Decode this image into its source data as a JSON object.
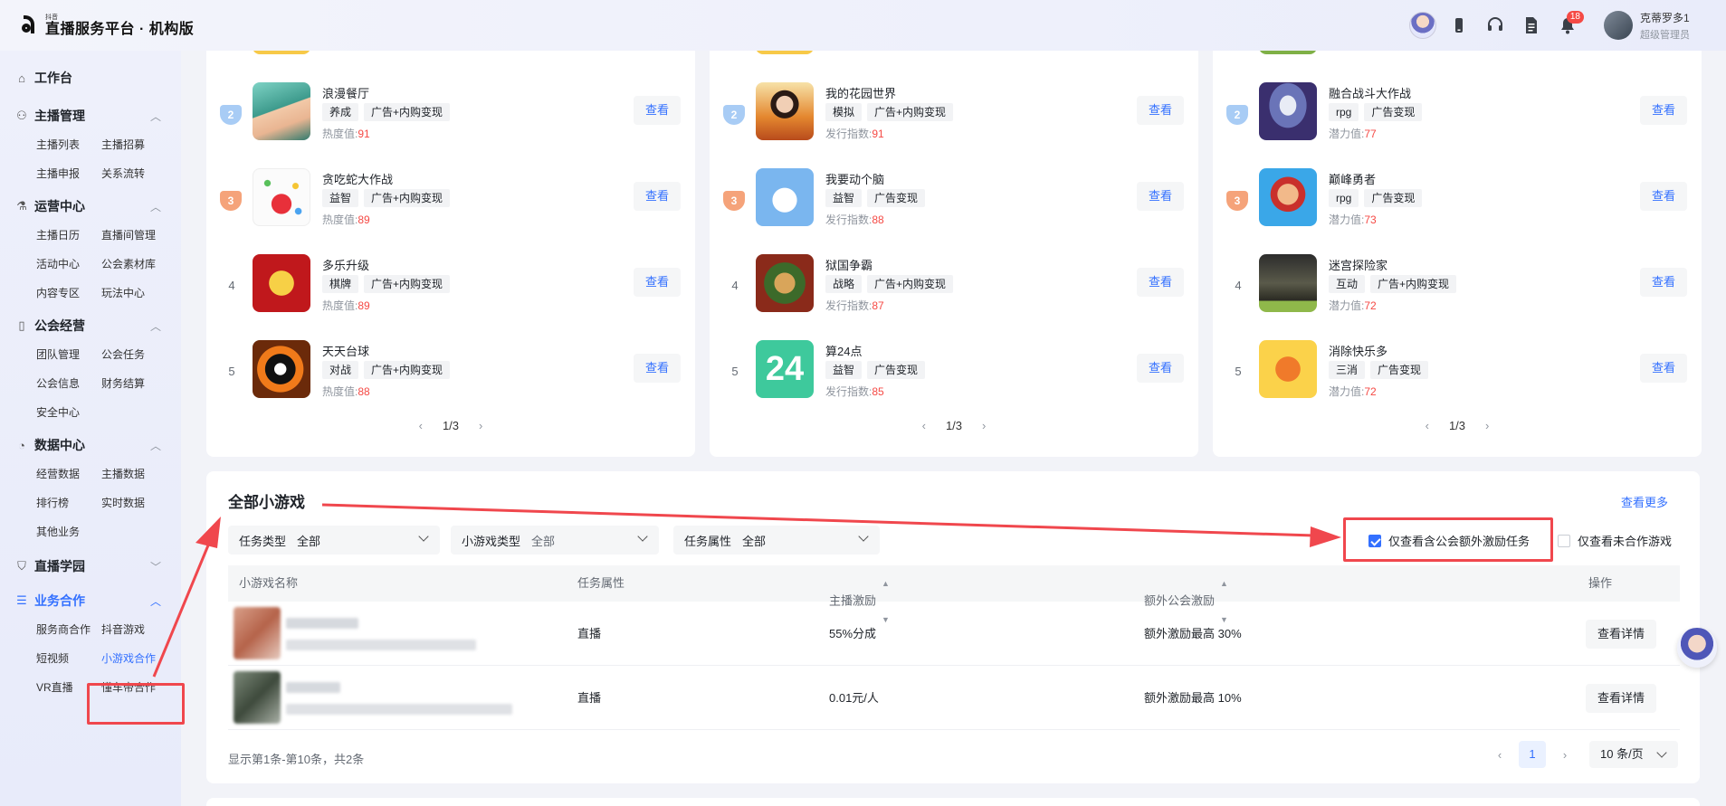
{
  "header": {
    "logo_small": "抖音",
    "title": "直播服务平台 · 机构版",
    "notification_count": "18",
    "user_name": "克蒂罗多1",
    "user_role": "超级管理员"
  },
  "sidebar": {
    "workbench": "工作台",
    "groups": [
      {
        "title": "主播管理",
        "items": [
          "主播列表",
          "主播招募",
          "主播申报",
          "关系流转"
        ]
      },
      {
        "title": "运营中心",
        "items": [
          "主播日历",
          "直播间管理",
          "活动中心",
          "公会素材库",
          "内容专区",
          "玩法中心"
        ]
      },
      {
        "title": "公会经营",
        "items": [
          "团队管理",
          "公会任务",
          "公会信息",
          "财务结算",
          "安全中心"
        ]
      },
      {
        "title": "数据中心",
        "items": [
          "经营数据",
          "主播数据",
          "排行榜",
          "实时数据",
          "其他业务"
        ]
      },
      {
        "title": "直播学园",
        "items": []
      },
      {
        "title": "业务合作",
        "items": [
          "服务商合作",
          "抖音游戏",
          "短视频",
          "小游戏合作",
          "VR直播",
          "懂车帝合作"
        ]
      }
    ]
  },
  "rank_cards": [
    {
      "rows": [
        {
          "rank": "2",
          "name": "浪漫餐厅",
          "tags": [
            "养成",
            "广告+内购变现"
          ],
          "metric_label": "热度值:",
          "metric_value": "91"
        },
        {
          "rank": "3",
          "name": "贪吃蛇大作战",
          "tags": [
            "益智",
            "广告+内购变现"
          ],
          "metric_label": "热度值:",
          "metric_value": "89"
        },
        {
          "rank": "4",
          "name": "多乐升级",
          "tags": [
            "棋牌",
            "广告+内购变现"
          ],
          "metric_label": "热度值:",
          "metric_value": "89"
        },
        {
          "rank": "5",
          "name": "天天台球",
          "tags": [
            "对战",
            "广告+内购变现"
          ],
          "metric_label": "热度值:",
          "metric_value": "88"
        }
      ],
      "page": "1/3"
    },
    {
      "rows": [
        {
          "rank": "2",
          "name": "我的花园世界",
          "tags": [
            "模拟",
            "广告+内购变现"
          ],
          "metric_label": "发行指数:",
          "metric_value": "91"
        },
        {
          "rank": "3",
          "name": "我要动个脑",
          "tags": [
            "益智",
            "广告变现"
          ],
          "metric_label": "发行指数:",
          "metric_value": "88"
        },
        {
          "rank": "4",
          "name": "狱国争霸",
          "tags": [
            "战略",
            "广告+内购变现"
          ],
          "metric_label": "发行指数:",
          "metric_value": "87"
        },
        {
          "rank": "5",
          "name": "算24点",
          "tags": [
            "益智",
            "广告变现"
          ],
          "metric_label": "发行指数:",
          "metric_value": "85"
        }
      ],
      "page": "1/3"
    },
    {
      "rows": [
        {
          "rank": "2",
          "name": "融合战斗大作战",
          "tags": [
            "rpg",
            "广告变现"
          ],
          "metric_label": "潜力值:",
          "metric_value": "77"
        },
        {
          "rank": "3",
          "name": "巅峰勇者",
          "tags": [
            "rpg",
            "广告变现"
          ],
          "metric_label": "潜力值:",
          "metric_value": "73"
        },
        {
          "rank": "4",
          "name": "迷宫探险家",
          "tags": [
            "互动",
            "广告+内购变现"
          ],
          "metric_label": "潜力值:",
          "metric_value": "72"
        },
        {
          "rank": "5",
          "name": "消除快乐多",
          "tags": [
            "三消",
            "广告变现"
          ],
          "metric_label": "潜力值:",
          "metric_value": "72"
        }
      ],
      "page": "1/3"
    }
  ],
  "view_label": "查看",
  "icon_text_24": "24",
  "games_panel": {
    "title": "全部小游戏",
    "more_link": "查看更多",
    "filters": [
      {
        "label": "任务类型",
        "value": "全部"
      },
      {
        "label": "小游戏类型",
        "value": "全部"
      },
      {
        "label": "任务属性",
        "value": "全部"
      }
    ],
    "checkbox_extra": "仅查看含公会额外激励任务",
    "checkbox_uncoop": "仅查看未合作游戏",
    "columns": [
      "小游戏名称",
      "任务属性",
      "主播激励",
      "额外公会激励",
      "操作"
    ],
    "rows": [
      {
        "attr": "直播",
        "anchor_incentive": "55%分成",
        "guild_incentive": "额外激励最高 30%"
      },
      {
        "attr": "直播",
        "anchor_incentive": "0.01元/人",
        "guild_incentive": "额外激励最高 10%"
      }
    ],
    "detail_label": "查看详情",
    "footer_info": "显示第1条-第10条，共2条",
    "current_page": "1",
    "page_size": "10 条/页"
  },
  "colors": {
    "accent": "#3370ff",
    "highlight": "#f0474d",
    "hot": "#f54a45"
  }
}
